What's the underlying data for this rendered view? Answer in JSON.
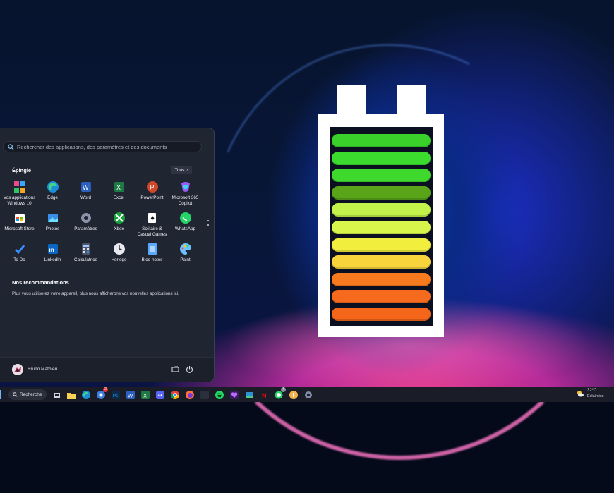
{
  "start_menu": {
    "search_placeholder": "Rechercher des applications, des paramètres et des documents",
    "pinned_title": "Épinglé",
    "all_button": "Tous",
    "pinned_apps": [
      {
        "label": "Vos applications\nWindows 10",
        "icon": "windows-apps-icon"
      },
      {
        "label": "Edge",
        "icon": "edge-icon"
      },
      {
        "label": "Word",
        "icon": "word-icon"
      },
      {
        "label": "Excel",
        "icon": "excel-icon"
      },
      {
        "label": "PowerPoint",
        "icon": "powerpoint-icon"
      },
      {
        "label": "Microsoft 365\nCopilot",
        "icon": "copilot-icon"
      },
      {
        "label": "Microsoft Store",
        "icon": "store-icon"
      },
      {
        "label": "Photos",
        "icon": "photos-icon"
      },
      {
        "label": "Paramètres",
        "icon": "settings-icon"
      },
      {
        "label": "Xbox",
        "icon": "xbox-icon"
      },
      {
        "label": "Solitaire &\nCasual Games",
        "icon": "solitaire-icon"
      },
      {
        "label": "WhatsApp",
        "icon": "whatsapp-icon"
      },
      {
        "label": "To Do",
        "icon": "todo-icon"
      },
      {
        "label": "LinkedIn",
        "icon": "linkedin-icon"
      },
      {
        "label": "Calculatrice",
        "icon": "calculator-icon"
      },
      {
        "label": "Horloge",
        "icon": "clock-icon"
      },
      {
        "label": "Bloc-notes",
        "icon": "notepad-icon"
      },
      {
        "label": "Paint",
        "icon": "paint-icon"
      }
    ],
    "recommendations_title": "Nos recommandations",
    "recommendations_text": "Plus vous utiliserez votre appareil, plus nous afficherons vos nouvelles applications ici.",
    "user_name": "Bruno Mathieu"
  },
  "taskbar": {
    "search_label": "Recherche",
    "badges": {
      "chrome_like": "2",
      "whatsapp": "4"
    },
    "weather_temp": "32°C",
    "weather_desc": "Éclaircies"
  },
  "battery": {
    "cell_colors": [
      "#3ad22a",
      "#3bdc2e",
      "#3fd92e",
      "#5aa41a",
      "#c3f24a",
      "#d8f54c",
      "#f2ee3e",
      "#f7d43c",
      "#f77a1e",
      "#f56a1c",
      "#f5661a"
    ]
  }
}
